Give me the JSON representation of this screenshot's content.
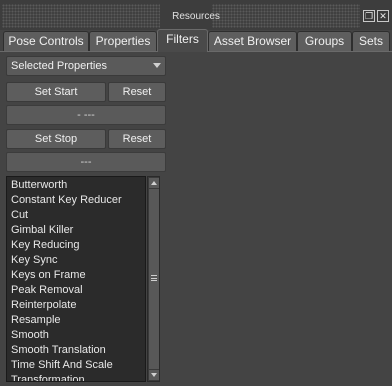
{
  "window": {
    "title": "Resources",
    "restore_icon": "restore-icon",
    "close_icon": "close-icon"
  },
  "tabs": [
    {
      "label": "Pose Controls",
      "active": false
    },
    {
      "label": "Properties",
      "active": false
    },
    {
      "label": "Filters",
      "active": true
    },
    {
      "label": "Asset Browser",
      "active": false
    },
    {
      "label": "Groups",
      "active": false
    },
    {
      "label": "Sets",
      "active": false
    }
  ],
  "filters": {
    "property_selector": {
      "value": "Selected Properties"
    },
    "start": {
      "set_label": "Set Start",
      "reset_label": "Reset",
      "value": "- ---"
    },
    "stop": {
      "set_label": "Set Stop",
      "reset_label": "Reset",
      "value": "---"
    },
    "list": [
      "Butterworth",
      "Constant Key Reducer",
      "Cut",
      "Gimbal Killer",
      "Key Reducing",
      "Key Sync",
      "Keys on Frame",
      "Peak Removal",
      "Reinterpolate",
      "Resample",
      "Smooth",
      "Smooth Translation",
      "Time Shift And Scale",
      "Transformation"
    ]
  }
}
